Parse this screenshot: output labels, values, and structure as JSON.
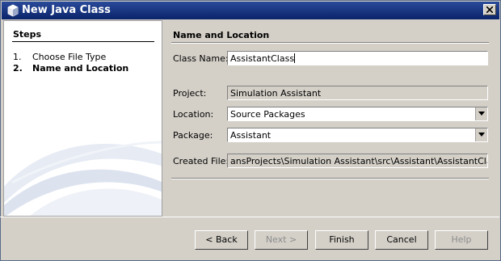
{
  "window": {
    "title": "New Java Class"
  },
  "steps": {
    "heading": "Steps",
    "items": [
      {
        "number": "1.",
        "label": "Choose File Type"
      },
      {
        "number": "2.",
        "label": "Name and Location"
      }
    ]
  },
  "form": {
    "heading": "Name and Location",
    "class_name_label": "Class Name:",
    "class_name_value": "AssistantClass",
    "project_label": "Project:",
    "project_value": "Simulation Assistant",
    "location_label": "Location:",
    "location_value": "Source Packages",
    "package_label": "Package:",
    "package_value": "Assistant",
    "created_file_label": "Created File:",
    "created_file_value": "ansProjects\\Simulation Assistant\\src\\Assistant\\AssistantClass.java"
  },
  "buttons": {
    "back": "< Back",
    "next": "Next >",
    "finish": "Finish",
    "cancel": "Cancel",
    "help": "Help"
  }
}
